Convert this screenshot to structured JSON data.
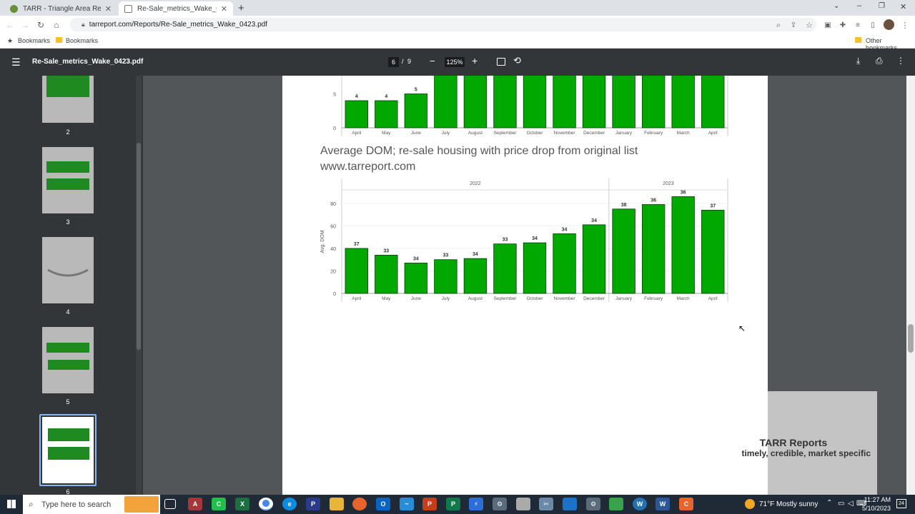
{
  "browser": {
    "tabs": [
      {
        "label": "TARR - Triangle Area Residential R",
        "active": false
      },
      {
        "label": "Re-Sale_metrics_Wake_0423.pdf",
        "active": true
      }
    ],
    "url": "tarreport.com/Reports/Re-Sale_metrics_Wake_0423.pdf",
    "bookmarks_label": "Bookmarks",
    "bookmark_folder": "Bookmarks",
    "other_bookmarks": "Other bookmarks"
  },
  "pdf": {
    "filename": "Re-Sale_metrics_Wake_0423.pdf",
    "current_page": "6",
    "page_sep": "/",
    "total_pages": "9",
    "zoom": "125%",
    "thumbnails": [
      {
        "num": "2"
      },
      {
        "num": "3"
      },
      {
        "num": "4"
      },
      {
        "num": "5"
      },
      {
        "num": "6",
        "selected": true
      }
    ],
    "heading": "Average DOM; re-sale housing with price drop from original list",
    "site": "www.tarreport.com",
    "brand_title": "TARR Reports",
    "brand_tagline": "timely, credible, market specific"
  },
  "chart_data": [
    {
      "type": "bar",
      "categories": [
        "April",
        "May",
        "June",
        "July",
        "August",
        "September",
        "October",
        "November",
        "December",
        "January",
        "February",
        "March",
        "April"
      ],
      "values": [
        4,
        4,
        5,
        null,
        null,
        null,
        null,
        null,
        null,
        null,
        null,
        null,
        null
      ],
      "labels": [
        "4",
        "4",
        "5",
        "",
        "",
        "",
        "",
        "",
        "",
        "",
        "",
        "",
        ""
      ],
      "yticks": [
        0,
        5
      ],
      "partially_visible": true,
      "color": "#00a800"
    },
    {
      "type": "bar",
      "title": "Average DOM; re-sale housing with price drop from original list",
      "groups": [
        {
          "label": "2022",
          "count": 9
        },
        {
          "label": "2023",
          "count": 4
        }
      ],
      "categories": [
        "April",
        "May",
        "June",
        "July",
        "August",
        "September",
        "October",
        "November",
        "December",
        "January",
        "February",
        "March",
        "April"
      ],
      "values": [
        40,
        34,
        27,
        30,
        31,
        44,
        45,
        53,
        61,
        75,
        79,
        86,
        74
      ],
      "labels": [
        "37",
        "33",
        "34",
        "33",
        "34",
        "33",
        "34",
        "34",
        "34",
        "38",
        "36",
        "36",
        "37"
      ],
      "ylabel": "Avg. DOM",
      "ylim": [
        0,
        92
      ],
      "yticks": [
        0,
        20,
        40,
        60,
        80
      ],
      "color": "#00a800"
    }
  ],
  "taskbar": {
    "search_placeholder": "Type here to search",
    "weather": "71°F  Mostly sunny",
    "time": "11:27 AM",
    "date": "5/10/2023"
  }
}
